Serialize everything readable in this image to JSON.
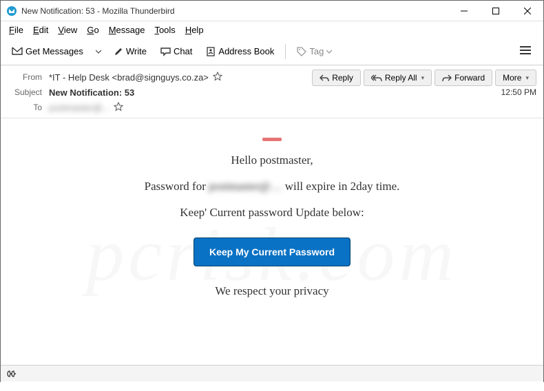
{
  "window": {
    "title": "New Notification: 53 - Mozilla Thunderbird"
  },
  "menu": {
    "file": "File",
    "edit": "Edit",
    "view": "View",
    "go": "Go",
    "message": "Message",
    "tools": "Tools",
    "help": "Help"
  },
  "toolbar": {
    "get_messages": "Get Messages",
    "write": "Write",
    "chat": "Chat",
    "address_book": "Address Book",
    "tag": "Tag"
  },
  "header": {
    "from_label": "From",
    "from_value": "*IT - Help Desk <brad@signguys.co.za>",
    "subject_label": "Subject",
    "subject_value": "New Notification: 53",
    "to_label": "To",
    "to_value": "postmaster@...",
    "time": "12:50 PM"
  },
  "actions": {
    "reply": "Reply",
    "reply_all": "Reply All",
    "forward": "Forward",
    "more": "More"
  },
  "email": {
    "greeting": "Hello postmaster,",
    "line1_pre": "Password for ",
    "line1_blur": "postmaster@…",
    "line1_post": " will expire in 2day time.",
    "line2": "Keep' Current password Update below:",
    "cta": "Keep My Current Password",
    "footer": "We respect your privacy"
  },
  "watermark": "pcrisk.com"
}
